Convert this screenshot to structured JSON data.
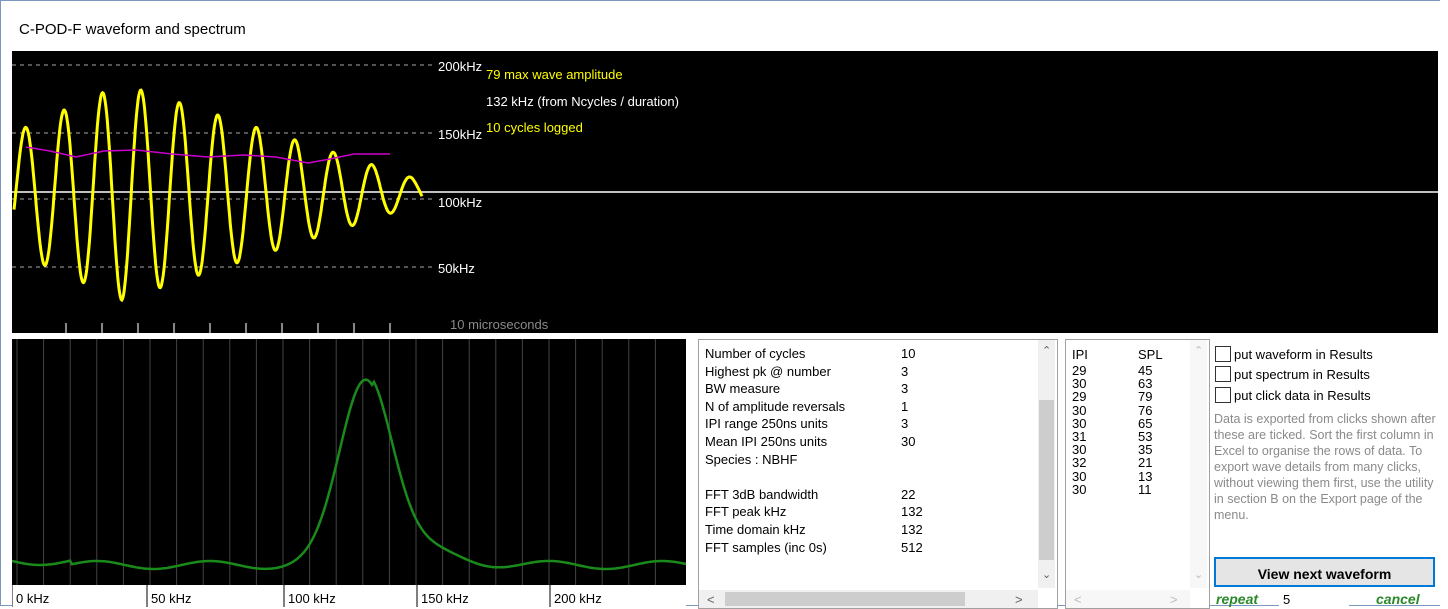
{
  "window": {
    "title": "C-POD-F waveform and spectrum"
  },
  "waveform": {
    "freq_labels": [
      "200kHz",
      "150kHz",
      "100kHz",
      "50kHz"
    ],
    "time_label": "10 microseconds",
    "info": [
      {
        "text": "79 max wave amplitude",
        "color": "#ffff00"
      },
      {
        "text": "132 kHz (from Ncycles / duration)",
        "color": "#ffffff"
      },
      {
        "text": "10 cycles logged",
        "color": "#ffff00"
      }
    ],
    "wave_color": "#ffff00",
    "freq_line_color": "#cc00cc"
  },
  "spectrum": {
    "x_labels": [
      "0 kHz",
      "50 kHz",
      "100 kHz",
      "150 kHz",
      "200 kHz"
    ],
    "line_color": "#1a8a1a"
  },
  "stats": {
    "rows": [
      {
        "name": "Number of cycles",
        "value": "10"
      },
      {
        "name": "Highest pk @ number",
        "value": "3"
      },
      {
        "name": "BW measure",
        "value": "3"
      },
      {
        "name": "N of amplitude reversals",
        "value": "1"
      },
      {
        "name": "IPI range 250ns units",
        "value": "3"
      },
      {
        "name": "Mean IPI 250ns units",
        "value": "30"
      },
      {
        "name": "Species :   NBHF",
        "value": ""
      },
      {
        "name": "",
        "value": ""
      },
      {
        "name": "FFT 3dB bandwidth",
        "value": "22"
      },
      {
        "name": "FFT peak kHz",
        "value": "132"
      },
      {
        "name": "Time domain kHz",
        "value": "132"
      },
      {
        "name": "FFT samples (inc 0s)",
        "value": "512"
      }
    ]
  },
  "ipi_table": {
    "headers": [
      "IPI",
      "SPL"
    ],
    "rows": [
      [
        "29",
        "45"
      ],
      [
        "30",
        "63"
      ],
      [
        "29",
        "79"
      ],
      [
        "30",
        "76"
      ],
      [
        "30",
        "65"
      ],
      [
        "31",
        "53"
      ],
      [
        "30",
        "35"
      ],
      [
        "32",
        "21"
      ],
      [
        "30",
        "13"
      ],
      [
        "30",
        "11"
      ]
    ]
  },
  "options": {
    "checkboxes": [
      "put waveform in Results",
      "put spectrum in Results",
      "put click data in Results"
    ],
    "note": "Data is exported from clicks shown after these are ticked. Sort the first column in Excel to organise the rows of data.   To export wave details from many clicks, without viewing them first, use the utility in section B on the Export page of the menu.",
    "button": "View  next  waveform",
    "repeat_label": "repeat",
    "repeat_value": "5",
    "cancel_label": "cancel"
  }
}
